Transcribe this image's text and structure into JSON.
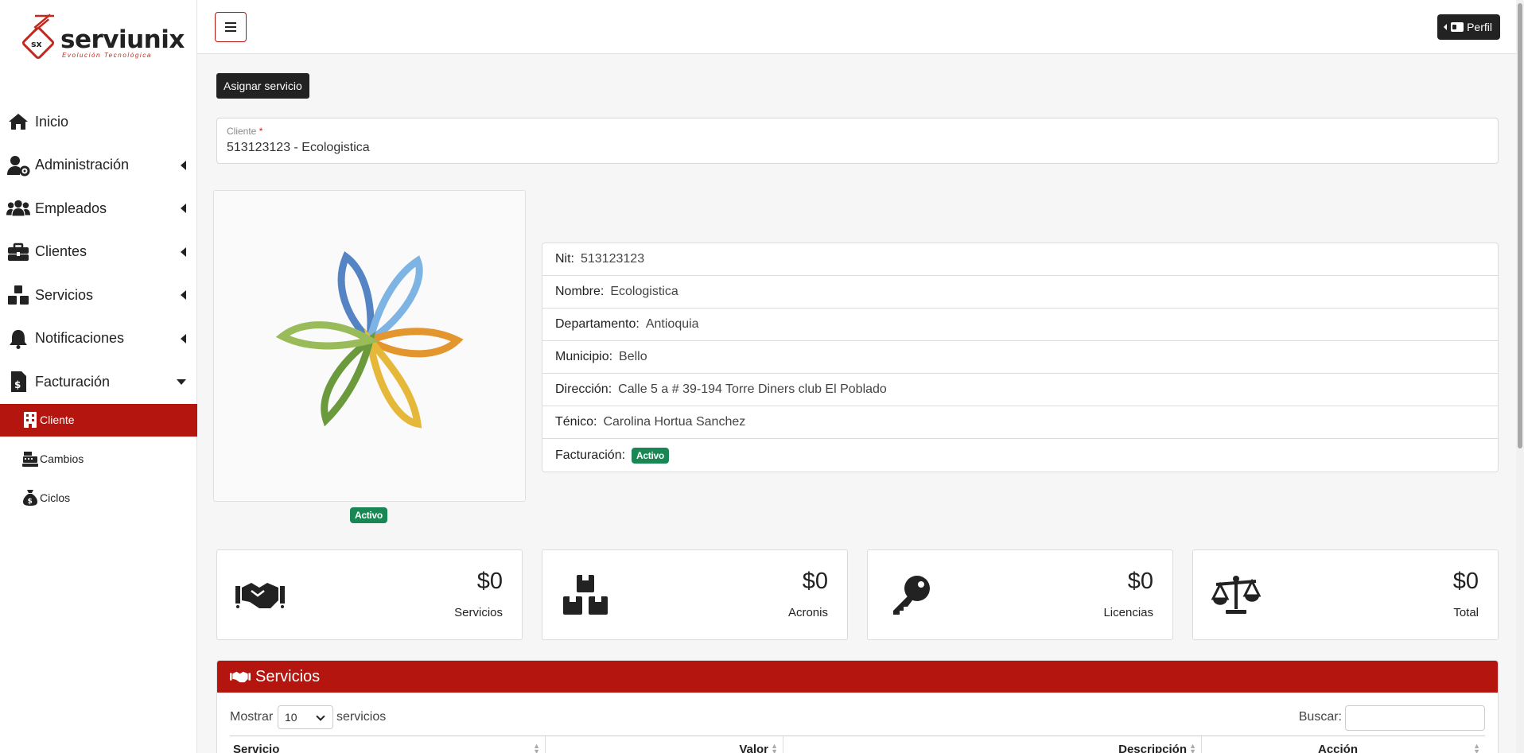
{
  "app": {
    "logo_text": "serviunix",
    "logo_tagline": "Evolución Tecnológica",
    "logo_mark": "sx"
  },
  "sidebar": {
    "items": [
      {
        "label": "Inicio",
        "icon": "home-icon"
      },
      {
        "label": "Administración",
        "icon": "user-gear-icon"
      },
      {
        "label": "Empleados",
        "icon": "users-icon"
      },
      {
        "label": "Clientes",
        "icon": "briefcase-icon"
      },
      {
        "label": "Servicios",
        "icon": "boxes-icon"
      },
      {
        "label": "Notificaciones",
        "icon": "bell-icon"
      },
      {
        "label": "Facturación",
        "icon": "invoice-icon"
      }
    ],
    "subitems": [
      {
        "label": "Cliente",
        "icon": "building-icon",
        "active": true
      },
      {
        "label": "Cambios",
        "icon": "cash-register-icon"
      },
      {
        "label": "Ciclos",
        "icon": "money-bag-icon"
      }
    ]
  },
  "topbar": {
    "menu_icon": "hamburger-icon",
    "profile_label": "Perfil"
  },
  "main": {
    "assign_button": "Asignar servicio",
    "client_field": {
      "label": "Cliente",
      "required_mark": "*",
      "value": "513123123 - Ecologistica"
    },
    "logo_status": "Activo",
    "info": {
      "nit_key": "Nit:",
      "nit_val": "513123123",
      "nombre_key": "Nombre:",
      "nombre_val": "Ecologistica",
      "depto_key": "Departamento:",
      "depto_val": "Antioquia",
      "municipio_key": "Municipio:",
      "municipio_val": "Bello",
      "direccion_key": "Dirección:",
      "direccion_val": "Calle 5 a # 39-194 Torre Diners club El Poblado",
      "tecnico_key": "Ténico:",
      "tecnico_val": "Carolina Hortua Sanchez",
      "facturacion_key": "Facturación:",
      "facturacion_val": "Activo"
    },
    "stats": [
      {
        "amount": "$0",
        "label": "Servicios",
        "icon": "handshake-icon"
      },
      {
        "amount": "$0",
        "label": "Acronis",
        "icon": "boxes-icon"
      },
      {
        "amount": "$0",
        "label": "Licencias",
        "icon": "key-icon"
      },
      {
        "amount": "$0",
        "label": "Total",
        "icon": "scale-icon"
      }
    ],
    "services_panel": {
      "title": "Servicios",
      "show_label": "Mostrar",
      "show_value": "10",
      "show_suffix": "servicios",
      "search_label": "Buscar:",
      "columns": [
        "Servicio",
        "Valor",
        "Descripción",
        "Acción"
      ]
    }
  },
  "colors": {
    "brand_red": "#b5150f",
    "success_green": "#198754",
    "dark": "#222222"
  }
}
